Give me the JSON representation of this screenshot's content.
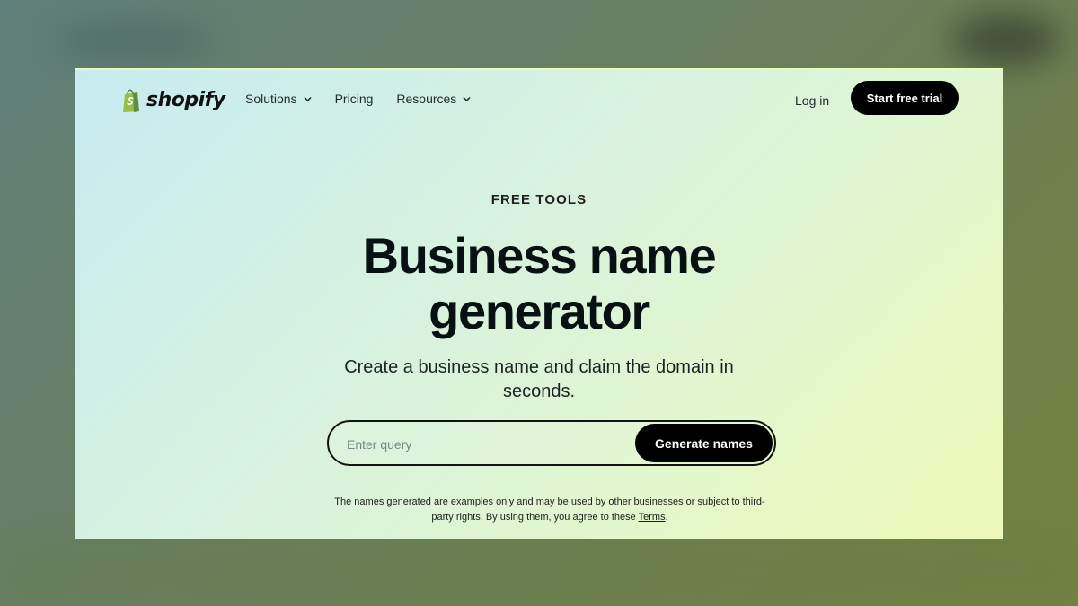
{
  "nav": {
    "logo_text": "shopify",
    "items": [
      {
        "label": "Solutions",
        "has_dropdown": true
      },
      {
        "label": "Pricing",
        "has_dropdown": false
      },
      {
        "label": "Resources",
        "has_dropdown": true
      }
    ],
    "login_label": "Log in",
    "cta_label": "Start free trial"
  },
  "hero": {
    "eyebrow": "FREE TOOLS",
    "headline_line1": "Business name",
    "headline_line2": "generator",
    "subheadline_line1": "Create a business name and claim the domain in",
    "subheadline_line2": "seconds."
  },
  "search": {
    "value": "",
    "placeholder": "Enter query",
    "button_label": "Generate names"
  },
  "footer_note": {
    "line1": "The names generated are examples only and may be used by other businesses or subject to third-",
    "line2_prefix": "party rights. By using them, you agree to these ",
    "terms_label": "Terms",
    "line2_suffix": "."
  },
  "icons": {
    "logo": "shopify-bag-icon",
    "dropdown": "chevron-down-icon"
  },
  "colors": {
    "brand_green": "#95bf47",
    "button_bg": "#000000",
    "text_primary": "#071012"
  }
}
